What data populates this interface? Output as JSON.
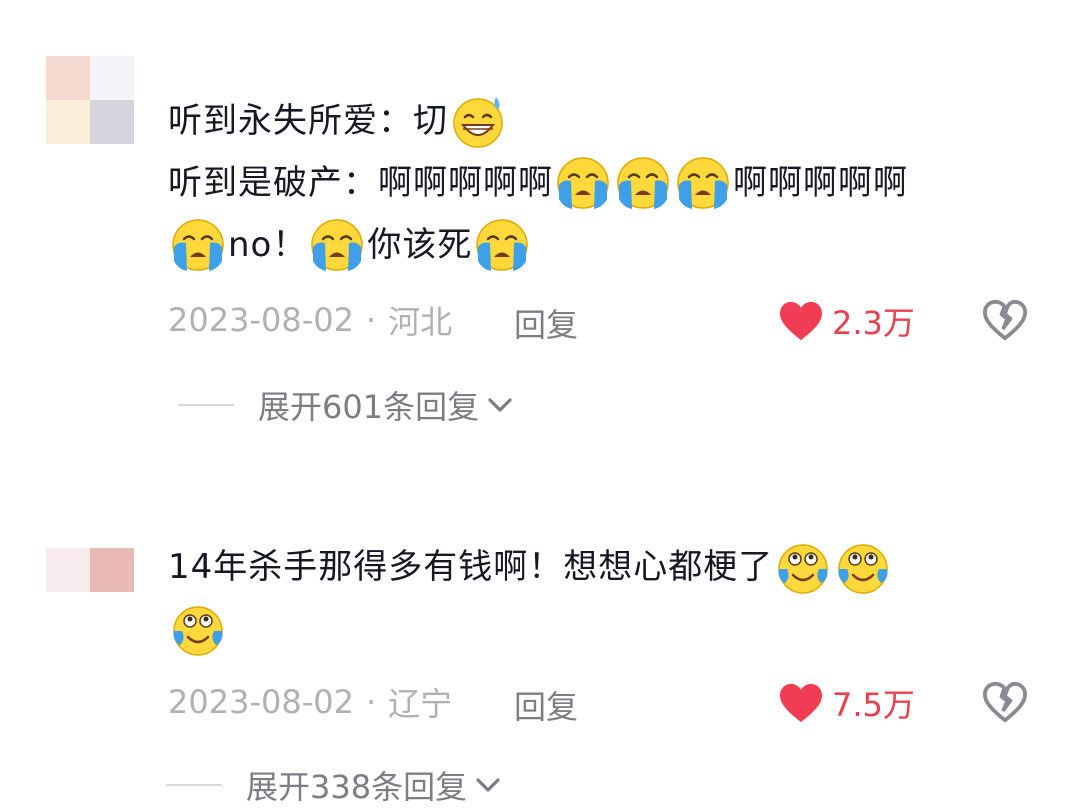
{
  "comments": [
    {
      "lines": [
        [
          {
            "t": "text",
            "v": "听到永失所爱：切"
          },
          {
            "t": "emoji",
            "icon": "sweat-grin-icon"
          }
        ],
        [
          {
            "t": "text",
            "v": "听到是破产：啊啊啊啊啊"
          },
          {
            "t": "emoji",
            "icon": "crying-icon"
          },
          {
            "t": "emoji",
            "icon": "crying-icon"
          },
          {
            "t": "emoji",
            "icon": "crying-icon"
          },
          {
            "t": "text",
            "v": "啊啊啊啊啊"
          }
        ],
        [
          {
            "t": "emoji",
            "icon": "crying-icon"
          },
          {
            "t": "text",
            "v": "no！"
          },
          {
            "t": "emoji",
            "icon": "crying-icon"
          },
          {
            "t": "text",
            "v": "你该死"
          },
          {
            "t": "emoji",
            "icon": "crying-icon"
          }
        ]
      ],
      "date": "2023-08-02",
      "separator": "·",
      "location": "河北",
      "reply_label": "回复",
      "like_count": "2.3万",
      "expand_label": "展开601条回复"
    },
    {
      "lines": [
        [
          {
            "t": "text",
            "v": "14年杀手那得多有钱啊！想想心都梗了"
          },
          {
            "t": "emoji",
            "icon": "tears-of-laughter-icon"
          },
          {
            "t": "emoji",
            "icon": "tears-of-laughter-icon"
          }
        ],
        [
          {
            "t": "emoji",
            "icon": "tears-of-laughter-icon"
          }
        ]
      ],
      "date": "2023-08-02",
      "separator": "·",
      "location": "辽宁",
      "reply_label": "回复",
      "like_count": "7.5万",
      "expand_label": "展开338条回复"
    }
  ],
  "colors": {
    "like": "#e8404f",
    "meta": "#b0b0b5",
    "reply": "#7d7d84",
    "text": "#161823"
  }
}
